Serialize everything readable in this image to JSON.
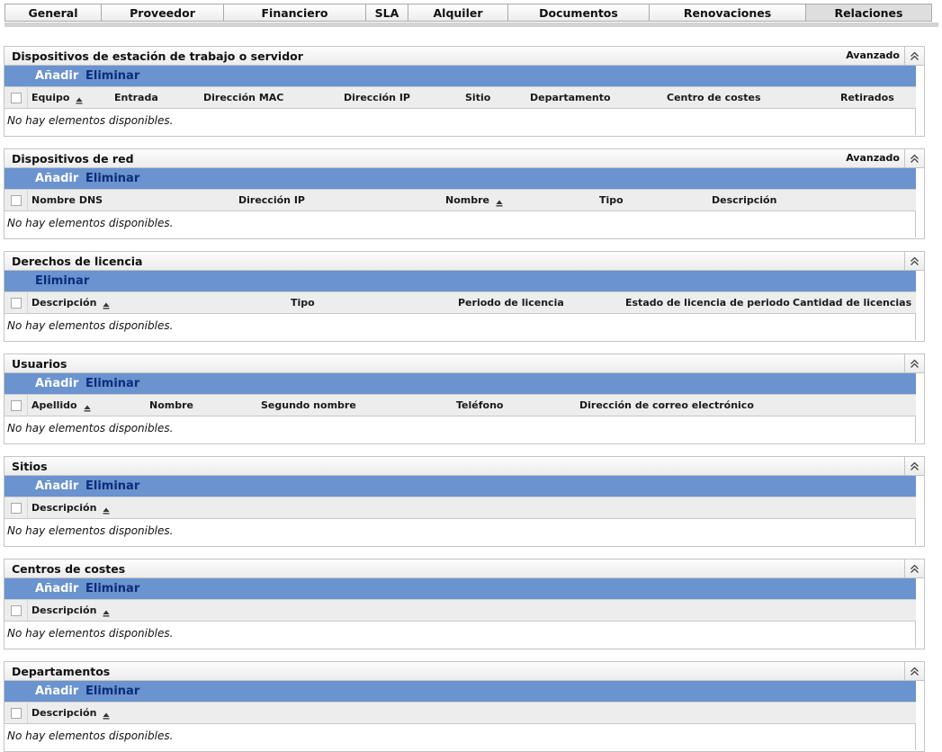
{
  "tabs": [
    "General",
    "Proveedor",
    "Financiero",
    "SLA",
    "Alquiler",
    "Documentos",
    "Renovaciones",
    "Relaciones"
  ],
  "active_tab": "Relaciones",
  "labels": {
    "add": "Añadir",
    "remove": "Eliminar",
    "empty": "No hay elementos disponibles."
  },
  "panels": [
    {
      "title": "Dispositivos de estación de trabajo o servidor",
      "advanced": "Avanzado",
      "has_add": true,
      "columns": [
        "Equipo",
        "Entrada",
        "Dirección MAC",
        "Dirección IP",
        "Sitio",
        "Departamento",
        "Centro de costes",
        "Retirados"
      ],
      "sorted_column": "Equipo"
    },
    {
      "title": "Dispositivos de red",
      "advanced": "Avanzado",
      "has_add": true,
      "columns": [
        "Nombre DNS",
        "Dirección IP",
        "Nombre",
        "Tipo",
        "Descripción"
      ],
      "sorted_column": "Nombre"
    },
    {
      "title": "Derechos de licencia",
      "advanced": "",
      "has_add": false,
      "columns": [
        "Descripción",
        "Tipo",
        "Periodo de licencia",
        "Estado de licencia de periodo",
        "Cantidad de licencias"
      ],
      "sorted_column": "Descripción"
    },
    {
      "title": "Usuarios",
      "advanced": "",
      "has_add": true,
      "columns": [
        "Apellido",
        "Nombre",
        "Segundo nombre",
        "Teléfono",
        "Dirección de correo electrónico"
      ],
      "sorted_column": "Apellido"
    },
    {
      "title": "Sitios",
      "advanced": "",
      "has_add": true,
      "columns": [
        "Descripción"
      ],
      "sorted_column": "Descripción"
    },
    {
      "title": "Centros de costes",
      "advanced": "",
      "has_add": true,
      "columns": [
        "Descripción"
      ],
      "sorted_column": "Descripción"
    },
    {
      "title": "Departamentos",
      "advanced": "",
      "has_add": true,
      "columns": [
        "Descripción"
      ],
      "sorted_column": "Descripción"
    }
  ],
  "colors": {
    "toolbar": "#6a93cf",
    "add_text": "#ffffff",
    "remove_text": "#0d2c7a",
    "header_bg": "#ededed"
  },
  "icons": {
    "collapse": "double-chevron-up-icon",
    "sort": "sort-ascending-icon"
  }
}
